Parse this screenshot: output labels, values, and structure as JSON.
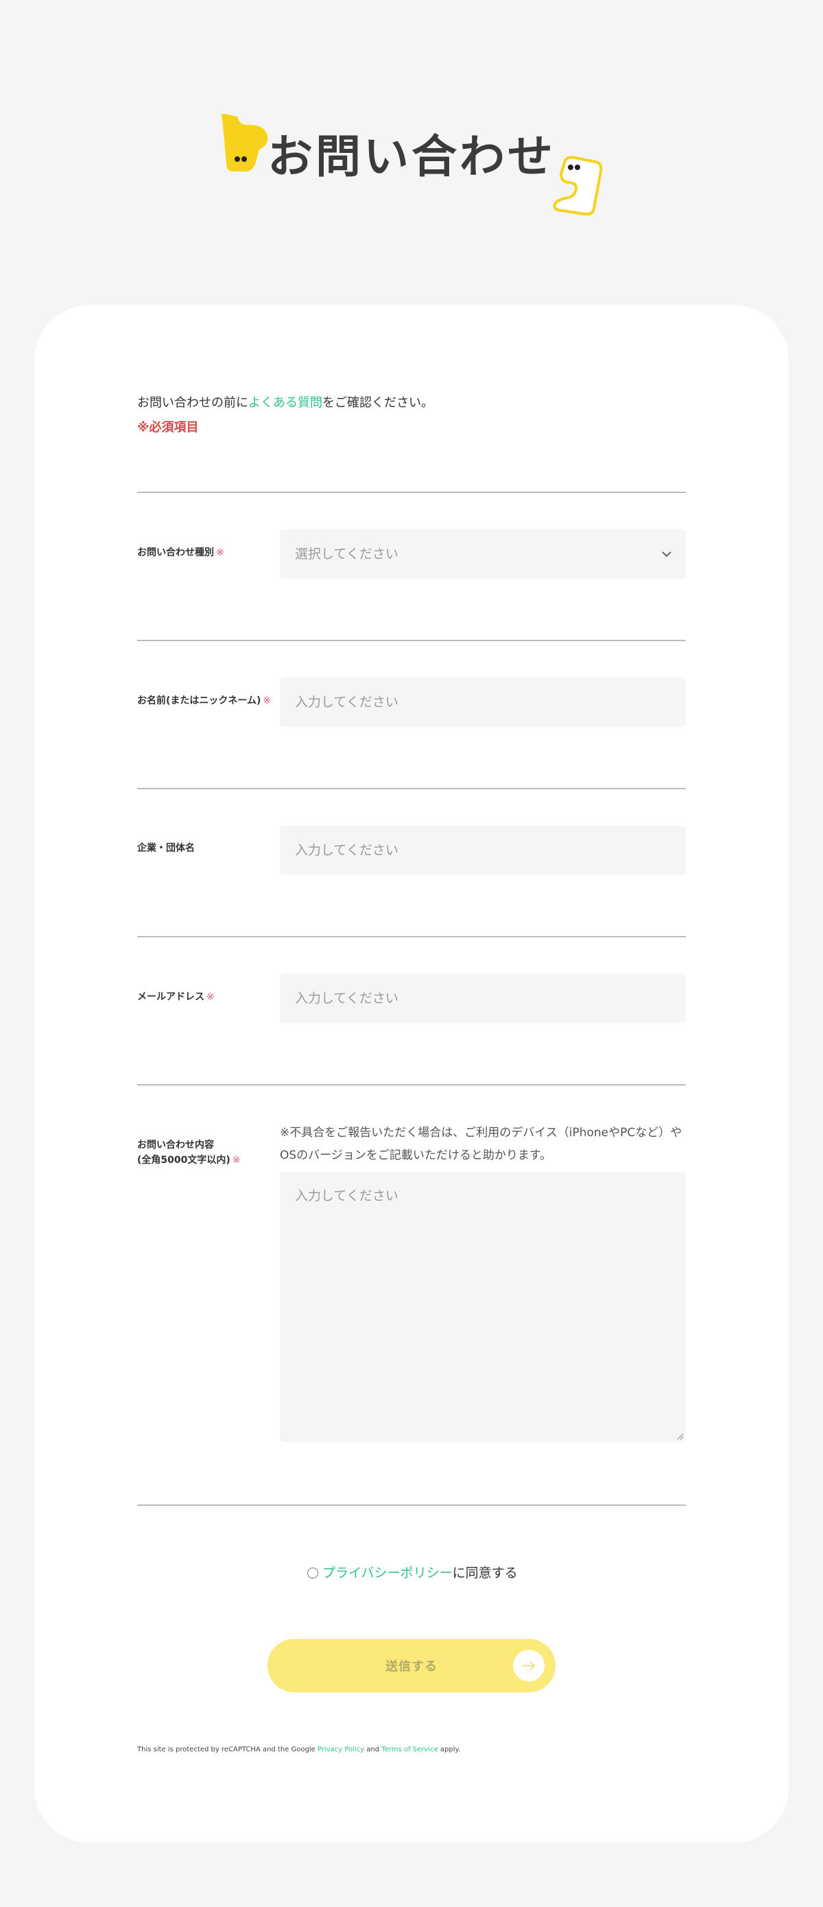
{
  "page": {
    "title": "お問い合わせ"
  },
  "intro": {
    "text_before": "お問い合わせの前に",
    "faq_link": "よくある質問",
    "text_after": "をご確認ください。",
    "required_note": "※必須項目"
  },
  "fields": {
    "inquiry_type": {
      "label": "お問い合わせ種別",
      "required_mark": "※",
      "placeholder": "選択してください"
    },
    "name": {
      "label": "お名前(またはニックネーム)",
      "required_mark": "※",
      "placeholder": "入力してください"
    },
    "company": {
      "label": "企業・団体名",
      "placeholder": "入力してください"
    },
    "email": {
      "label": "メールアドレス",
      "required_mark": "※",
      "placeholder": "入力してください"
    },
    "content": {
      "label_line1": "お問い合わせ内容",
      "label_line2": "(全角5000文字以内)",
      "required_mark": "※",
      "note": "※不具合をご報告いただく場合は、ご利用のデバイス（iPhoneやPCなど）やOSのバージョンをご記載いただけると助かります。",
      "placeholder": "入力してください"
    }
  },
  "agreement": {
    "privacy_link": "プライバシーポリシー",
    "text": "に同意する"
  },
  "submit": {
    "label": "送信する"
  },
  "recaptcha": {
    "text_before": "This site is protected by reCAPTCHA and the Google",
    "privacy_link": "Privacy Policy",
    "and": "and",
    "terms_link": "Terms of Service",
    "text_after": "apply."
  },
  "colors": {
    "accent_green": "#2fbf8f",
    "brand_yellow": "#fbe97a",
    "required_red": "#d64a4a",
    "mascot_yellow": "#f6d21d"
  },
  "icons": [
    "mascot-left-icon",
    "mascot-right-icon",
    "chevron-down-icon",
    "arrow-right-icon",
    "resize-handle-icon",
    "radio-icon"
  ]
}
